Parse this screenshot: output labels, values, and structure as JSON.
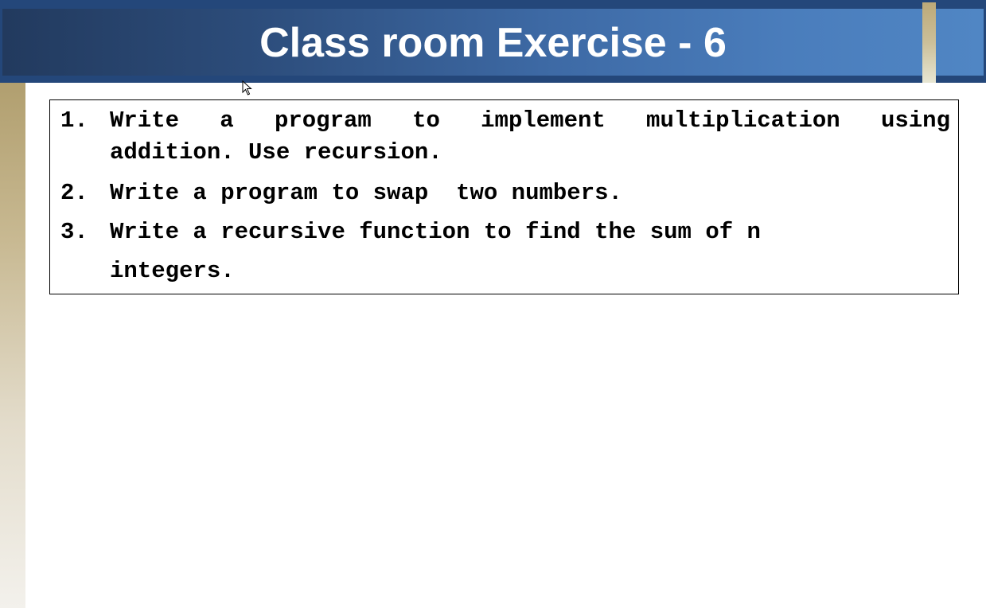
{
  "slide": {
    "title": "Class room Exercise - 6"
  },
  "exercises": [
    {
      "number": "1.",
      "lines": [
        "Write a program to implement multiplication using",
        "addition. Use recursion."
      ]
    },
    {
      "number": "2.",
      "lines": [
        "Write a program to swap  two numbers."
      ]
    },
    {
      "number": "3.",
      "lines": [
        "Write a recursive function to find the sum of n",
        "integers."
      ]
    }
  ],
  "colors": {
    "header_dark": "#24477a",
    "header_light": "#5086c4",
    "accent_gold": "#bca978",
    "title_text": "#ffffff",
    "body_text": "#000000"
  },
  "icons": {
    "cursor": "mouse-pointer-icon"
  }
}
